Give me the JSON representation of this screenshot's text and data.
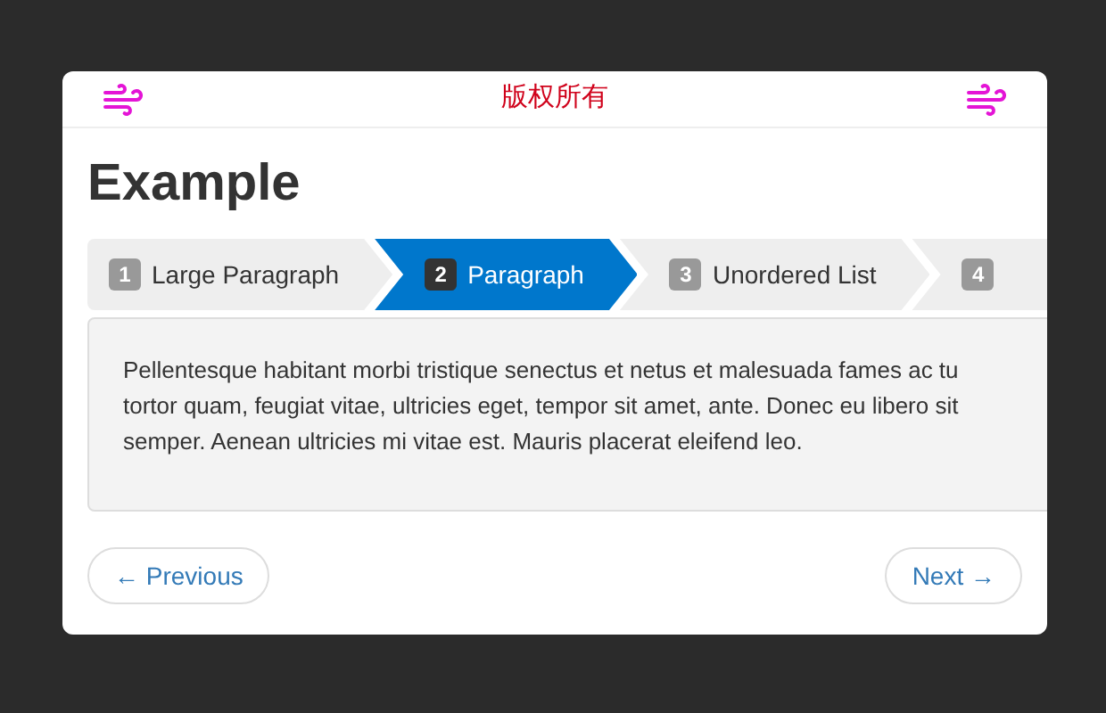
{
  "header": {
    "title": "版权所有"
  },
  "heading": "Example",
  "steps": [
    {
      "number": "1",
      "label": "Large Paragraph",
      "selected": false
    },
    {
      "number": "2",
      "label": "Paragraph",
      "selected": true
    },
    {
      "number": "3",
      "label": "Unordered List",
      "selected": false
    },
    {
      "number": "4",
      "selected": false
    }
  ],
  "panel": {
    "lines": [
      "Pellentesque habitant morbi tristique senectus et netus et malesuada fames ac tu",
      "tortor quam, feugiat vitae, ultricies eget, tempor sit amet, ante. Donec eu libero sit",
      "semper. Aenean ultricies mi vitae est. Mauris placerat eleifend leo."
    ]
  },
  "buttons": {
    "previous": "← Previous",
    "next": "Next →"
  }
}
